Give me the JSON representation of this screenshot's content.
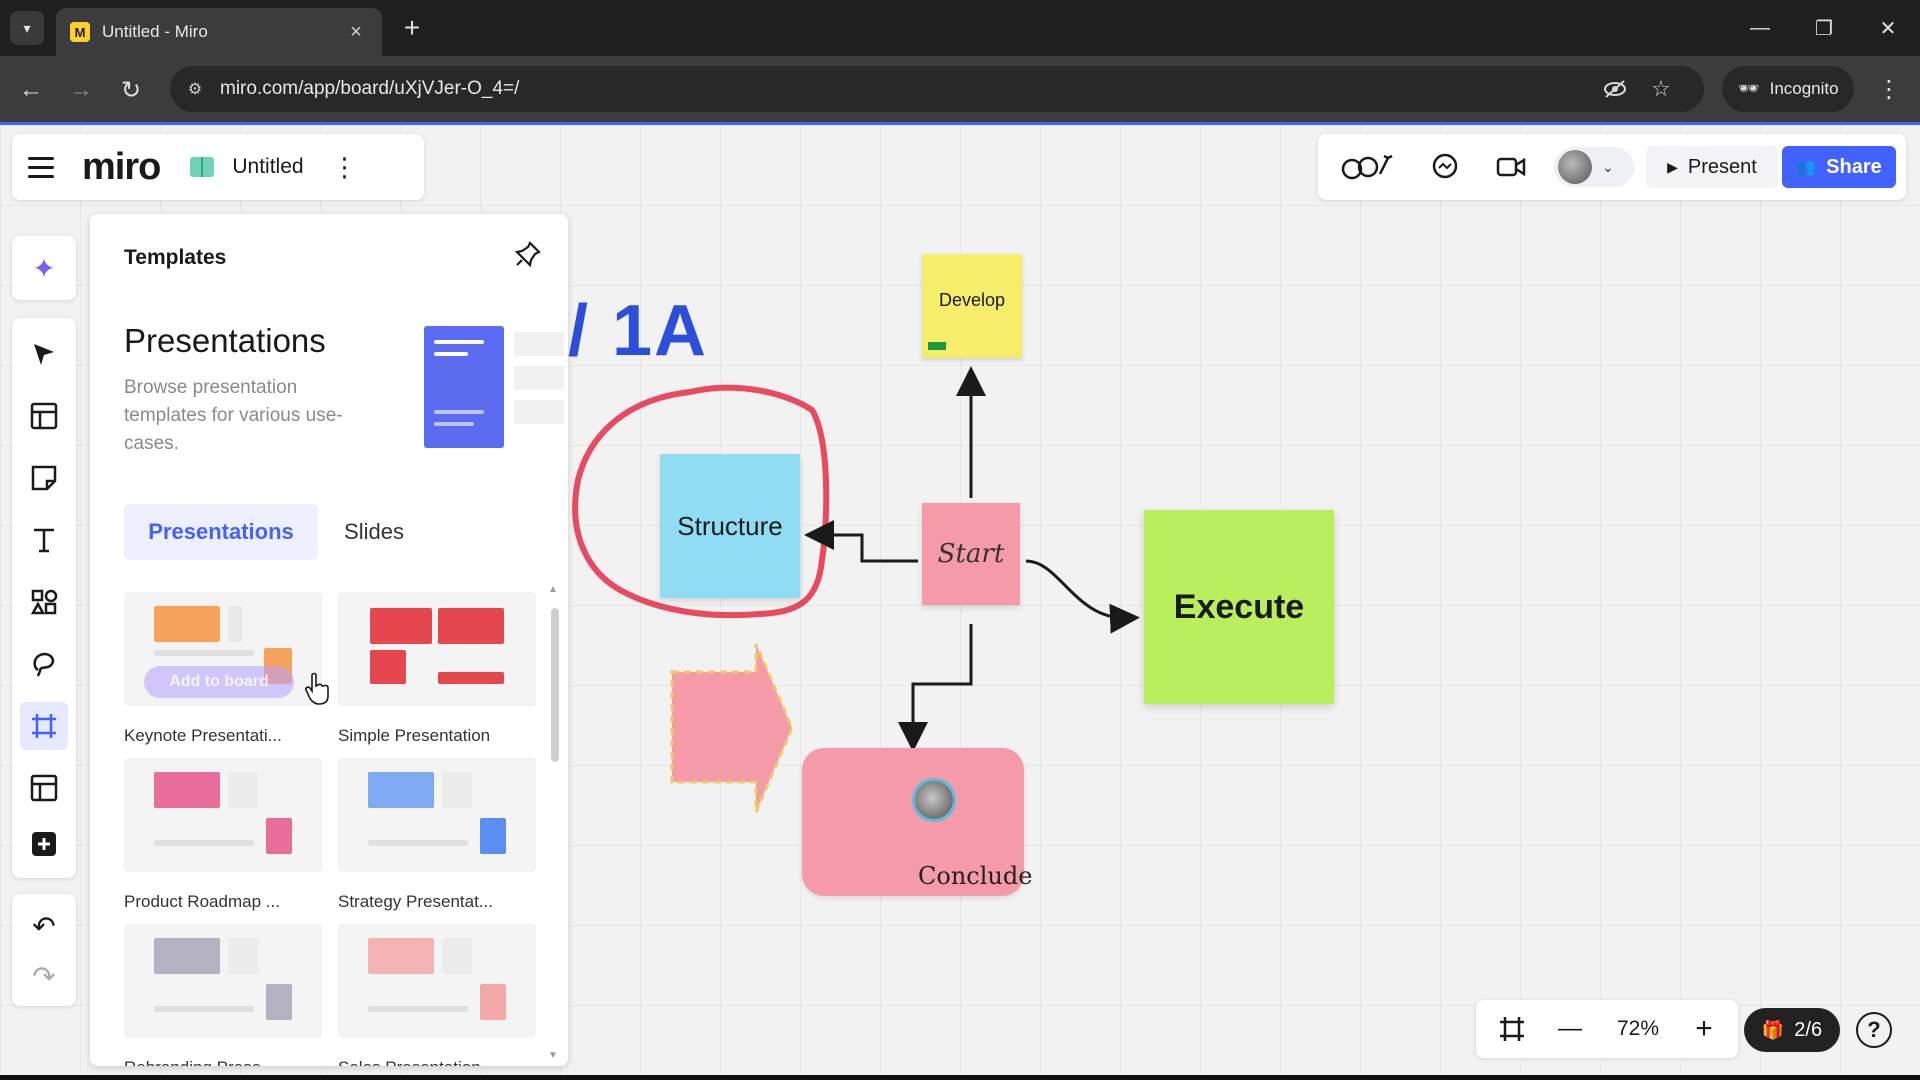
{
  "browser": {
    "tab_title": "Untitled - Miro",
    "tab_favicon": "M",
    "url": "miro.com/app/board/uXjVJer-O_4=/",
    "incognito_label": "Incognito"
  },
  "board": {
    "logo": "miro",
    "name": "Untitled"
  },
  "collab": {
    "present_label": "Present",
    "share_label": "Share"
  },
  "toolbar": {
    "tools": [
      "ai-sparkle",
      "select",
      "templates",
      "sticky-note",
      "text",
      "shapes",
      "lasso",
      "frame",
      "table",
      "add"
    ]
  },
  "templates_panel": {
    "header": "Templates",
    "title": "Presentations",
    "description": "Browse presentation templates for various use-cases.",
    "tabs": [
      "Presentations",
      "Slides"
    ],
    "active_tab": "Presentations",
    "hover_action": "Add to board",
    "cards": [
      {
        "label": "Keynote Presentati..."
      },
      {
        "label": "Simple Presentation"
      },
      {
        "label": "Product Roadmap ..."
      },
      {
        "label": "Strategy Presentat..."
      },
      {
        "label": "Rebranding Prese..."
      },
      {
        "label": "Sales Presentation"
      }
    ]
  },
  "canvas": {
    "partial_title": "/ 1A",
    "stickies": {
      "develop": "Develop",
      "structure": "Structure",
      "start": "Start",
      "execute": "Execute",
      "conclude": "Conclude"
    }
  },
  "zoom": {
    "level": "72%",
    "pages": "2/6",
    "help": "?"
  },
  "colors": {
    "accent": "#4262ff",
    "develop": "#f6ed6d",
    "structure": "#8fdcf3",
    "start": "#f59aa8",
    "execute": "#b9ee5c",
    "circle_outline": "#e84a5f"
  }
}
